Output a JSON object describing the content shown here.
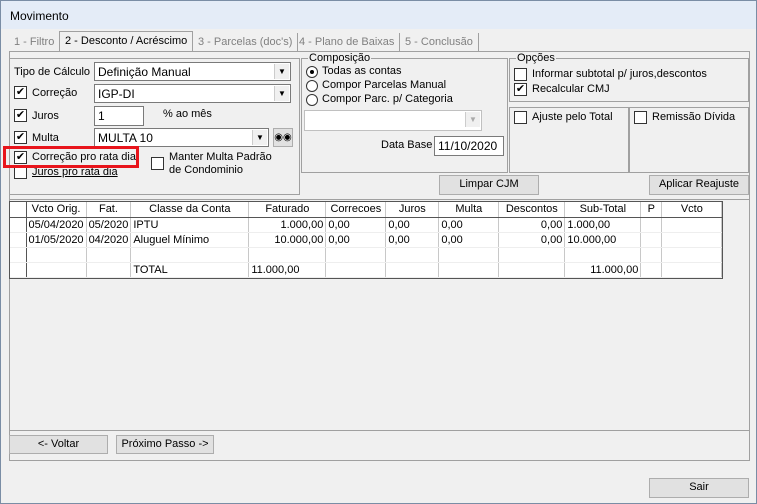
{
  "window": {
    "title": "Movimento"
  },
  "tabs": [
    "1 - Filtro",
    "2 - Desconto / Acréscimo",
    "3 - Parcelas (doc's)",
    "4 - Plano de Baixas",
    "5 - Conclusão"
  ],
  "calc": {
    "tipo_label": "Tipo de Cálculo",
    "tipo_value": "Definição Manual",
    "correcao_label": "Correção",
    "correcao_value": "IGP-DI",
    "juros_label": "Juros",
    "juros_value": "1",
    "juros_unit": "% ao mês",
    "multa_label": "Multa",
    "multa_value": "MULTA 10",
    "correcao_pro_rata": "Correção pro rata dia",
    "juros_pro_rata": "Juros pro rata dia",
    "manter_multa_1": "Manter Multa Padrão",
    "manter_multa_2": "de Condominio"
  },
  "composicao": {
    "title": "Composição",
    "options": [
      "Todas as contas",
      "Compor Parcelas Manual",
      "Compor Parc. p/ Categoria"
    ],
    "data_base_label": "Data Base",
    "data_base": "11/10/2020"
  },
  "opcoes": {
    "title": "Opções",
    "informar": "Informar subtotal p/ juros,descontos",
    "recalcular": "Recalcular CMJ",
    "ajuste": "Ajuste pelo Total",
    "remissao": "Remissão Dívida"
  },
  "buttons": {
    "limpar": "Limpar CJM",
    "aplicar": "Aplicar Reajuste",
    "voltar": "<- Voltar",
    "proximo": "Próximo Passo ->",
    "sair": "Sair"
  },
  "grid": {
    "headers": [
      "Vcto Orig.",
      "Fat.",
      "Classe da Conta",
      "Faturado",
      "Correcoes",
      "Juros",
      "Multa",
      "Descontos",
      "Sub-Total",
      "P",
      "Vcto"
    ],
    "rows": [
      [
        "05/04/2020",
        "05/2020",
        "IPTU",
        "1.000,00",
        "0,00",
        "0,00",
        "0,00",
        "0,00",
        "1.000,00",
        "",
        ""
      ],
      [
        "01/05/2020",
        "04/2020",
        "Aluguel Mínimo",
        "10.000,00",
        "0,00",
        "0,00",
        "0,00",
        "0,00",
        "10.000,00",
        "",
        ""
      ]
    ],
    "total": {
      "label": "TOTAL",
      "faturado": "11.000,00",
      "subtotal": "11.000,00"
    }
  }
}
